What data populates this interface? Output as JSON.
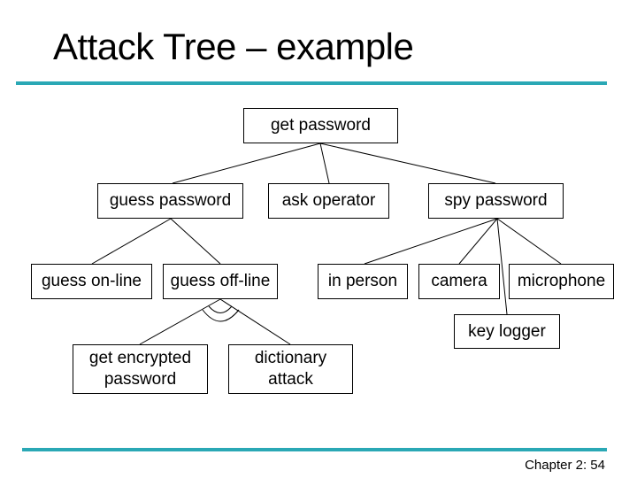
{
  "slide": {
    "title": "Attack Tree – example",
    "footer": "Chapter 2: 54",
    "accent_color": "#2aa8b5"
  },
  "tree": {
    "nodes": [
      {
        "id": "get-password",
        "label": "get password",
        "parent": null
      },
      {
        "id": "guess-password",
        "label": "guess password",
        "parent": "get-password"
      },
      {
        "id": "ask-operator",
        "label": "ask operator",
        "parent": "get-password"
      },
      {
        "id": "spy-password",
        "label": "spy password",
        "parent": "get-password"
      },
      {
        "id": "guess-on-line",
        "label": "guess on-line",
        "parent": "guess-password"
      },
      {
        "id": "guess-off-line",
        "label": "guess off-line",
        "parent": "guess-password"
      },
      {
        "id": "in-person",
        "label": "in person",
        "parent": "spy-password"
      },
      {
        "id": "camera",
        "label": "camera",
        "parent": "spy-password"
      },
      {
        "id": "microphone",
        "label": "microphone",
        "parent": "spy-password"
      },
      {
        "id": "key-logger",
        "label": "key logger",
        "parent": "spy-password"
      },
      {
        "id": "get-encrypted-password",
        "label": "get encrypted\npassword",
        "parent": "guess-off-line"
      },
      {
        "id": "dictionary-attack",
        "label": "dictionary\nattack",
        "parent": "guess-off-line"
      }
    ],
    "and_nodes": [
      "guess-off-line"
    ]
  }
}
